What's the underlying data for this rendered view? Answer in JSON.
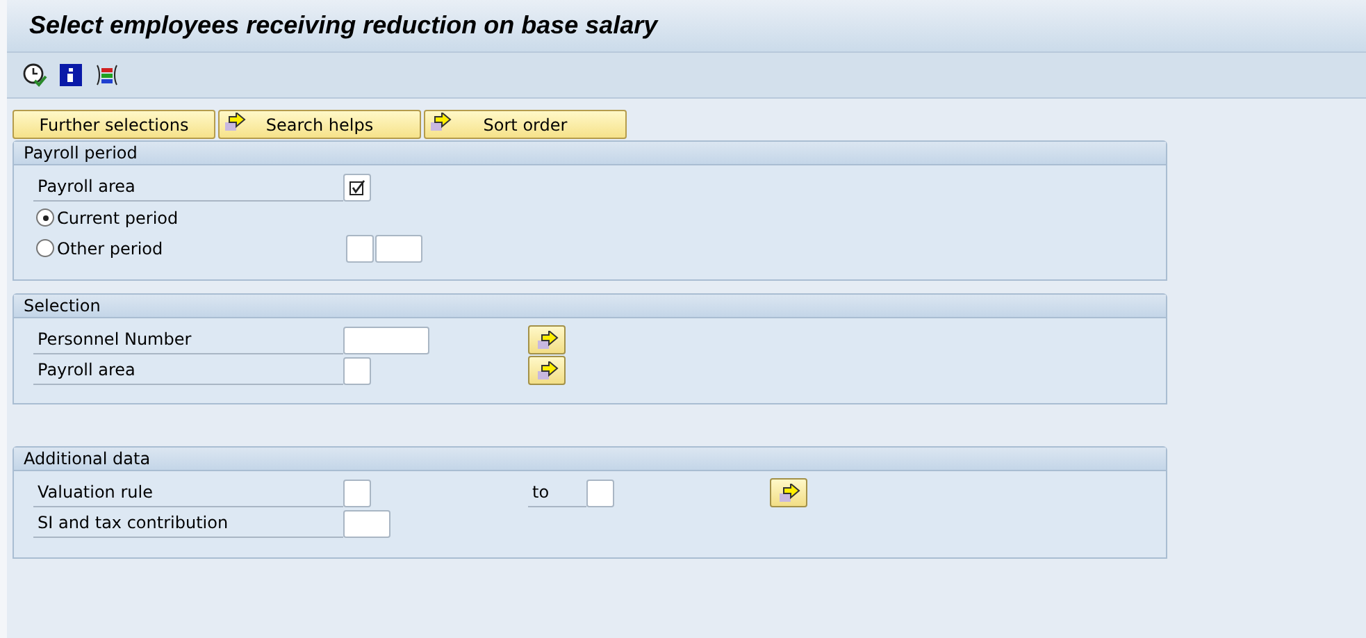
{
  "window": {
    "title": "Select employees receiving reduction on base salary"
  },
  "buttons": [
    {
      "label": "Further selections",
      "kind": "plain"
    },
    {
      "label": "Search helps",
      "kind": "arrow"
    },
    {
      "label": "Sort order",
      "kind": "arrow"
    }
  ],
  "groups": [
    {
      "title": "Payroll period",
      "rows": [
        {
          "kind": "checkbox",
          "label": "Payroll area",
          "checked": true
        },
        {
          "kind": "radio",
          "label": "Current period",
          "selected": true
        },
        {
          "kind": "radio_period",
          "label": "Other period",
          "selected": false
        }
      ]
    },
    {
      "title": "Selection",
      "rows": [
        {
          "kind": "long_input",
          "label": "Personnel Number",
          "multiple_selection": true
        },
        {
          "kind": "short_input",
          "label": "Payroll area",
          "multiple_selection": true
        }
      ]
    },
    {
      "title": "Additional data",
      "rows": [
        {
          "kind": "range",
          "label": "Valuation rule",
          "to_label": "to",
          "multiple_selection": true
        },
        {
          "kind": "medium_input",
          "label": "SI and tax contribution",
          "multiple_selection": false
        }
      ]
    }
  ]
}
